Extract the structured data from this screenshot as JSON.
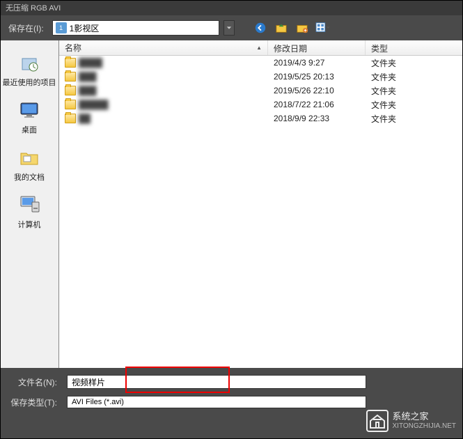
{
  "window_title": "无压缩 RGB AVI",
  "toolbar": {
    "save_in_label": "保存在(I):",
    "location": "1影视区"
  },
  "sidebar": {
    "items": [
      {
        "label": "最近使用的项目",
        "icon": "recent"
      },
      {
        "label": "桌面",
        "icon": "desktop"
      },
      {
        "label": "我的文档",
        "icon": "documents"
      },
      {
        "label": "计算机",
        "icon": "computer"
      }
    ]
  },
  "headers": {
    "name": "名称",
    "date": "修改日期",
    "type": "类型"
  },
  "files": [
    {
      "name": "████",
      "date": "2019/4/3 9:27",
      "type": "文件夹"
    },
    {
      "name": "███",
      "date": "2019/5/25 20:13",
      "type": "文件夹"
    },
    {
      "name": "███",
      "date": "2019/5/26 22:10",
      "type": "文件夹"
    },
    {
      "name": "█████",
      "date": "2018/7/22 21:06",
      "type": "文件夹"
    },
    {
      "name": "██",
      "date": "2018/9/9 22:33",
      "type": "文件夹"
    }
  ],
  "bottom": {
    "filename_label": "文件名(N):",
    "filename_value": "视频样片",
    "filetype_label": "保存类型(T):",
    "filetype_value": "AVI Files (*.avi)"
  },
  "watermark": {
    "brand": "系统之家",
    "url": "XITONGZHIJIA.NET"
  }
}
